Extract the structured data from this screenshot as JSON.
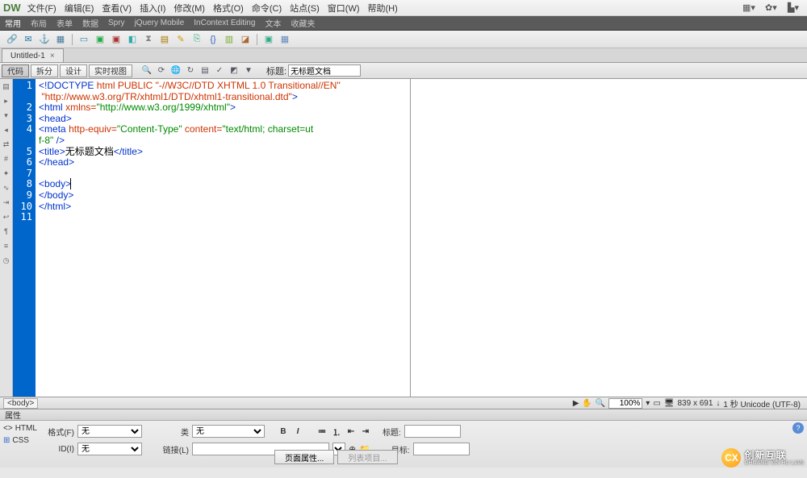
{
  "app": {
    "logo": "DW"
  },
  "menus": [
    "文件(F)",
    "编辑(E)",
    "查看(V)",
    "插入(I)",
    "修改(M)",
    "格式(O)",
    "命令(C)",
    "站点(S)",
    "窗口(W)",
    "帮助(H)"
  ],
  "categories": [
    "常用",
    "布局",
    "表单",
    "数据",
    "Spry",
    "jQuery Mobile",
    "InContext Editing",
    "文本",
    "收藏夹"
  ],
  "doc_tab": {
    "title": "Untitled-1",
    "close": "×"
  },
  "view_buttons": [
    "代码",
    "拆分",
    "设计",
    "实时视图"
  ],
  "title_field": {
    "label": "标题:",
    "value": "无标题文档"
  },
  "code_lines": [
    [
      [
        "tag",
        "<!DOCTYPE"
      ],
      [
        "txt",
        " "
      ],
      [
        "attr",
        "html PUBLIC \"-//W3C//DTD XHTML 1.0 Transitional//EN\" \"http://www.w3.org/TR/xhtml1/DTD/xhtml1-transitional.dtd\""
      ],
      [
        "tag",
        ">"
      ]
    ],
    [
      [
        "tag",
        "<html"
      ],
      [
        "txt",
        " "
      ],
      [
        "attr",
        "xmlns="
      ],
      [
        "str",
        "\"http://www.w3.org/1999/xhtml\""
      ],
      [
        "tag",
        ">"
      ]
    ],
    [
      [
        "tag",
        "<head>"
      ]
    ],
    [
      [
        "tag",
        "<meta"
      ],
      [
        "txt",
        " "
      ],
      [
        "attr",
        "http-equiv="
      ],
      [
        "str",
        "\"Content-Type\""
      ],
      [
        "txt",
        " "
      ],
      [
        "attr",
        "content="
      ],
      [
        "str",
        "\"text/html; charset=utf-8\""
      ],
      [
        "txt",
        " "
      ],
      [
        "tag",
        "/>"
      ]
    ],
    [
      [
        "tag",
        "<title>"
      ],
      [
        "txt",
        "无标题文档"
      ],
      [
        "tag",
        "</title>"
      ]
    ],
    [
      [
        "tag",
        "</head>"
      ]
    ],
    [
      [
        "txt",
        ""
      ]
    ],
    [
      [
        "tag",
        "<body>"
      ],
      [
        "cursor",
        ""
      ]
    ],
    [
      [
        "tag",
        "</body>"
      ]
    ],
    [
      [
        "tag",
        "</html>"
      ]
    ],
    [
      [
        "txt",
        ""
      ]
    ]
  ],
  "tag_crumb": "<body>",
  "status": {
    "zoom": "100%",
    "dims": "839 x 691",
    "encoding": "1 秒 Unicode (UTF-8)"
  },
  "properties": {
    "header": "属性",
    "html_mode": "HTML",
    "css_mode": "CSS",
    "format_label": "格式(F)",
    "format_value": "无",
    "class_label": "类",
    "class_value": "无",
    "id_label": "ID(I)",
    "id_value": "无",
    "link_label": "链接(L)",
    "title2_label": "标题:",
    "target_label": "目标:",
    "page_props_btn": "页面属性...",
    "list_btn": "列表项目..."
  },
  "watermark": {
    "cn": "创新互联",
    "en": "CHUANG XIN HU LIAN"
  }
}
